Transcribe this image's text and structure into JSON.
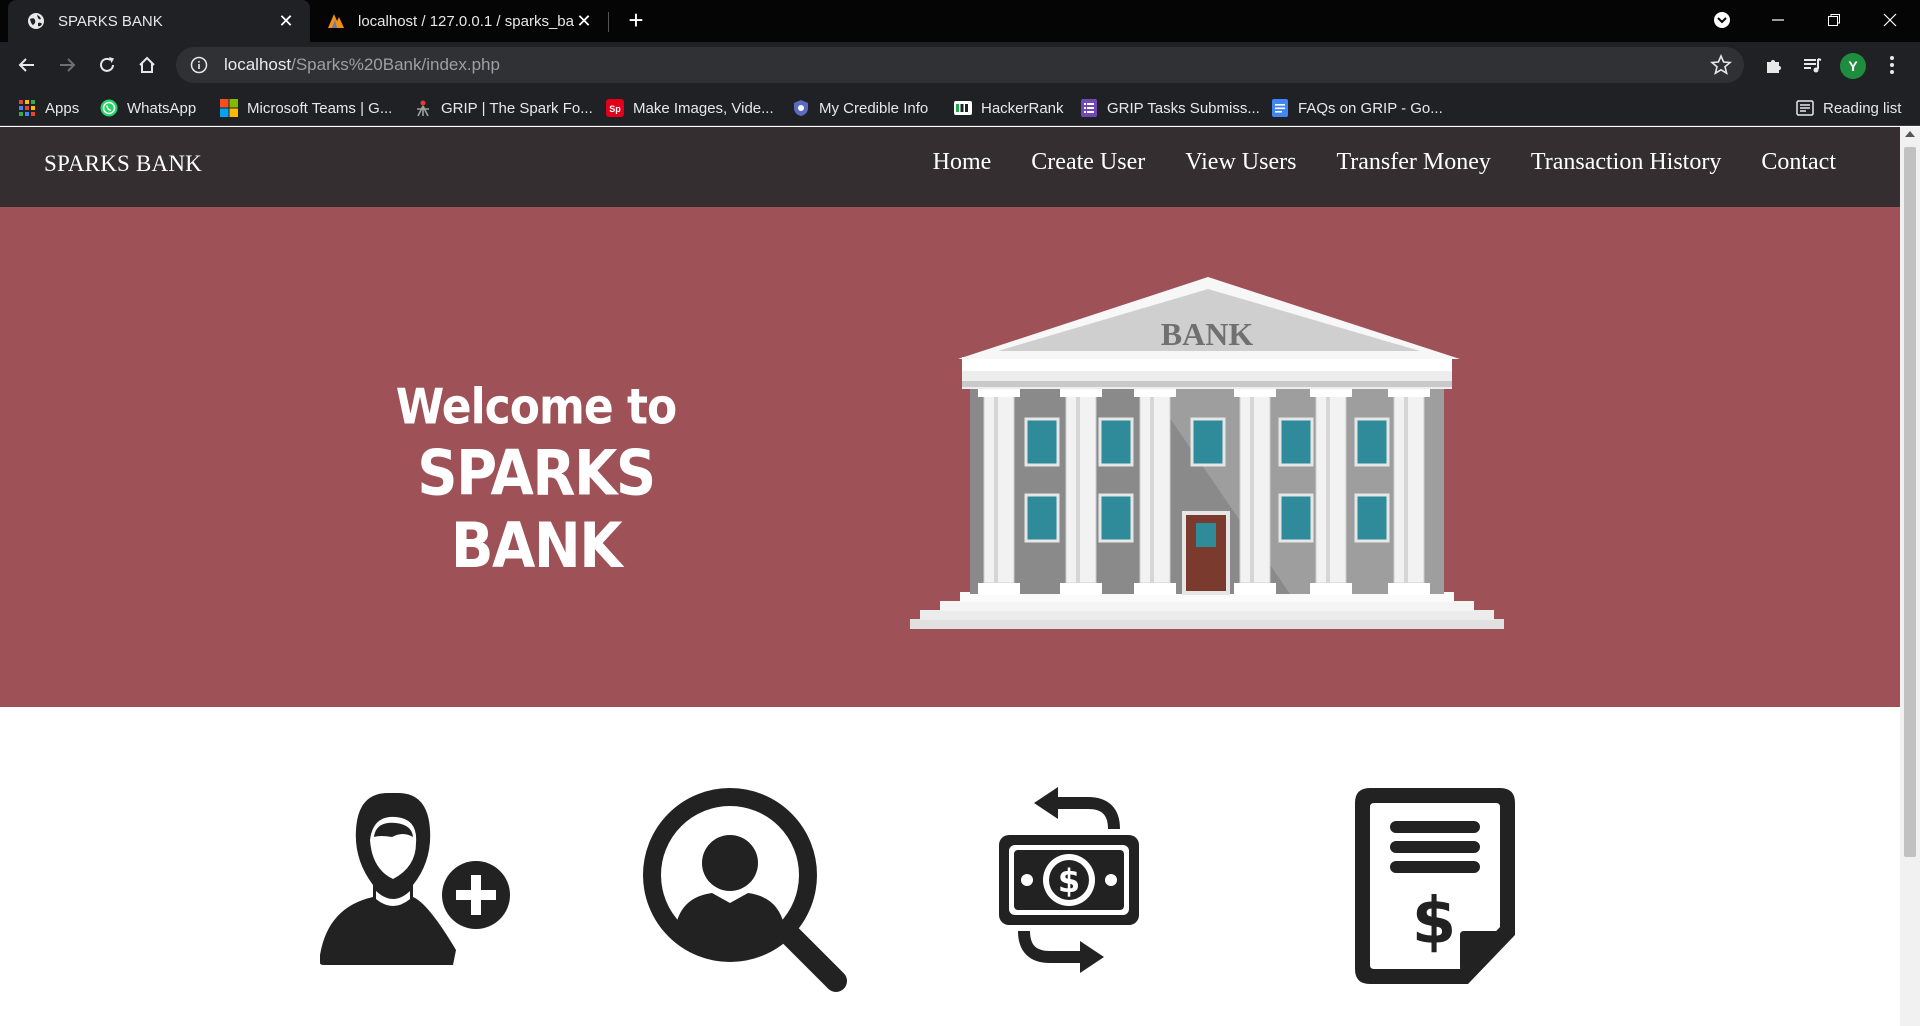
{
  "browser": {
    "tabs": [
      {
        "title": "SPARKS BANK",
        "active": true
      },
      {
        "title": "localhost / 127.0.0.1 / sparks_bar",
        "active": false
      }
    ],
    "url_host": "localhost",
    "url_path": "/Sparks%20Bank/index.php",
    "profile_initial": "Y",
    "bookmarks": [
      {
        "label": "Apps",
        "icon": "apps-grid-icon"
      },
      {
        "label": "WhatsApp",
        "icon": "whatsapp-icon"
      },
      {
        "label": "Microsoft Teams | G...",
        "icon": "microsoft-icon"
      },
      {
        "label": "GRIP | The Spark Fo...",
        "icon": "spark-foundation-icon"
      },
      {
        "label": "Make Images, Vide...",
        "icon": "spark-adobe-icon"
      },
      {
        "label": "My Credible Info",
        "icon": "credible-info-icon"
      },
      {
        "label": "HackerRank",
        "icon": "hackerrank-icon"
      },
      {
        "label": "GRIP Tasks Submiss...",
        "icon": "google-forms-icon"
      },
      {
        "label": "FAQs on GRIP - Go...",
        "icon": "google-docs-icon"
      }
    ],
    "reading_list": "Reading list"
  },
  "site": {
    "brand": "SPARKS BANK",
    "nav": [
      "Home",
      "Create User",
      "View Users",
      "Transfer Money",
      "Transaction History",
      "Contact"
    ],
    "hero": {
      "line1": "Welcome to",
      "line2": "SPARKS BANK",
      "building_sign": "BANK"
    },
    "features": [
      {
        "icon": "add-user-icon"
      },
      {
        "icon": "search-user-icon"
      },
      {
        "icon": "money-transfer-icon"
      },
      {
        "icon": "transaction-receipt-icon"
      }
    ]
  },
  "colors": {
    "navbar": "#342e30",
    "hero": "#9e5156",
    "icon_dark": "#222222"
  }
}
